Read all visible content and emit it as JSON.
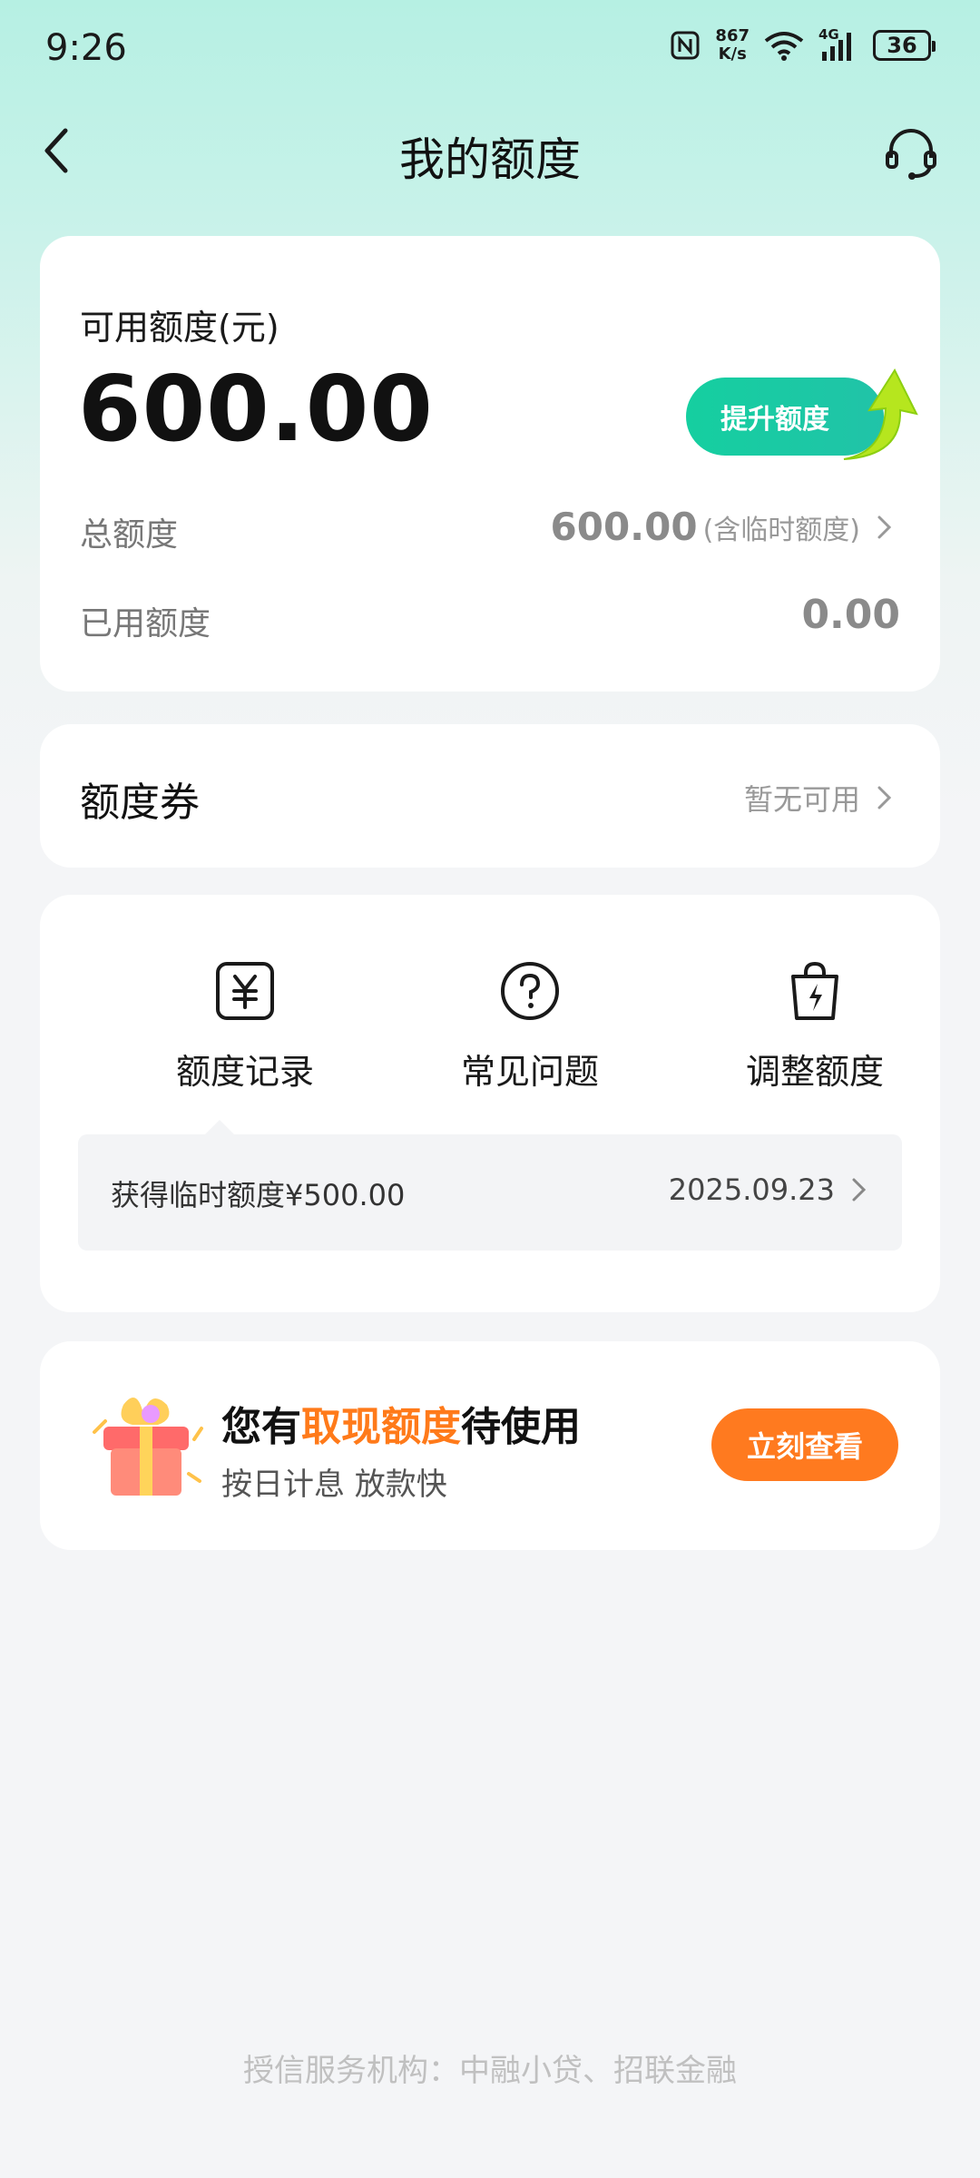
{
  "status_bar": {
    "time": "9:26",
    "net_speed_value": "867",
    "net_speed_unit": "K/s",
    "signal": "4G",
    "battery": "36"
  },
  "header": {
    "title": "我的额度"
  },
  "quota": {
    "available_label": "可用额度(元)",
    "available_amount": "600.00",
    "raise_button": "提升额度",
    "total_label": "总额度",
    "total_value": "600.00",
    "total_note": "(含临时额度)",
    "used_label": "已用额度",
    "used_value": "0.00"
  },
  "coupon": {
    "title": "额度券",
    "status": "暂无可用"
  },
  "menu": {
    "items": [
      {
        "label": "额度记录",
        "icon": "yuan-icon"
      },
      {
        "label": "常见问题",
        "icon": "question-icon"
      },
      {
        "label": "调整额度",
        "icon": "bag-lightning-icon"
      }
    ],
    "record_tip": {
      "text": "获得临时额度¥500.00",
      "date": "2025.09.23"
    }
  },
  "promo": {
    "prefix": "您有",
    "highlight": "取现额度",
    "suffix": "待使用",
    "subtitle": "按日计息 放款快",
    "button": "立刻查看"
  },
  "footer": {
    "text": "授信服务机构：中融小贷、招联金融"
  },
  "colors": {
    "brand_green": "#15cfa0",
    "promo_orange": "#ff7a1a",
    "header_bg": "#b6f0e3"
  }
}
